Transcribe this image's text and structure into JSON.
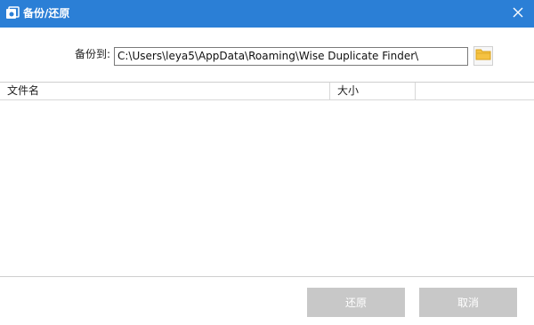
{
  "window": {
    "title": "备份/还原",
    "app_icon": "app-logo-icon",
    "close_icon": "close-icon",
    "titlebar_color": "#2b7fd6"
  },
  "backup": {
    "label": "备份到:",
    "path": "C:\\Users\\leya5\\AppData\\Roaming\\Wise Duplicate Finder\\",
    "browse_icon": "folder-icon"
  },
  "table": {
    "columns": [
      "文件名",
      "大小",
      ""
    ],
    "rows": []
  },
  "buttons": {
    "restore": "还原",
    "cancel": "取消",
    "disabled_color": "#c8c8c8"
  }
}
